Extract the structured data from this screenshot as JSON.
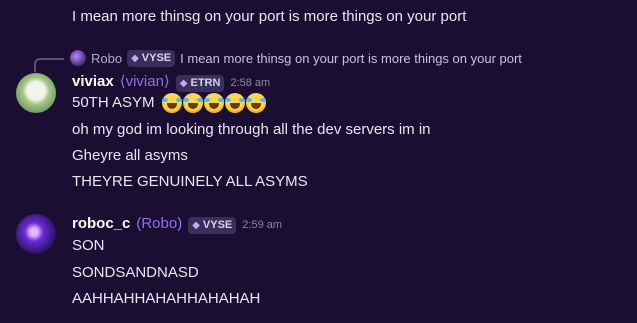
{
  "prev_message": {
    "text": "I mean more thinsg on your port is more things on your port"
  },
  "reply": {
    "author": "Robo",
    "tag": "VYSE",
    "text": "I mean more thinsg on your port is more things on your port"
  },
  "msg1": {
    "username": "viviax",
    "display_name": "⟨vivian⟩",
    "tag": "ETRN",
    "time": "2:58 am",
    "lines": [
      "50TH ASYM",
      "oh my god im looking through all the dev servers im in",
      "Gheyre all asyms",
      "THEYRE GENUINELY ALL ASYMS"
    ],
    "emoji_count": 5
  },
  "msg2": {
    "username": "roboc_c",
    "display_name": "(Robo)",
    "tag": "VYSE",
    "time": "2:59 am",
    "lines": [
      "SON",
      "SONDSANDNASD",
      "AAHHAHHAHAHHAHAHAH"
    ]
  },
  "icons": {
    "reply_avatar": "avatar-icon",
    "tag_gem": "gem-icon",
    "emoji": "joy-emoji-icon"
  },
  "colors": {
    "background": "#1a0f33",
    "display_name": "#8e72e8",
    "tag_bg": "#3a2f5a"
  }
}
